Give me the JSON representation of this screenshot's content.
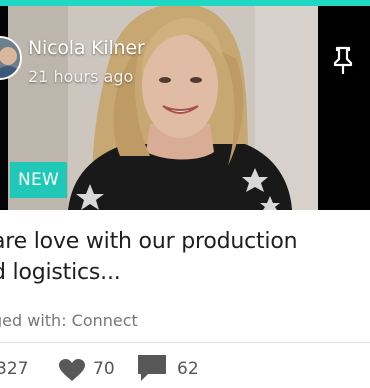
{
  "author": {
    "name": "Nicola Kilner",
    "time_ago": "21 hours ago",
    "avatar_icon": "user-avatar"
  },
  "video": {
    "badge": "NEW",
    "pin_icon": "pin-icon"
  },
  "post": {
    "title_line1": "are love with our production",
    "title_line2": "d logistics...",
    "tags": "ged with: Connect"
  },
  "stats": {
    "views": "327",
    "likes": "70",
    "comments": "62",
    "likes_icon": "heart-icon",
    "comments_icon": "comment-icon"
  },
  "colors": {
    "accent": "#1fd8c3",
    "badge": "#20c9b7"
  }
}
